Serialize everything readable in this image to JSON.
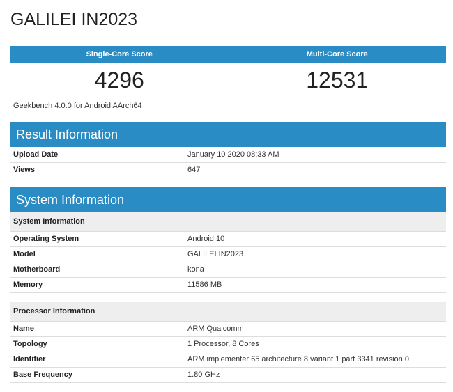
{
  "device_title": "GALILEI IN2023",
  "scores": {
    "single_label": "Single-Core Score",
    "multi_label": "Multi-Core Score",
    "single_value": "4296",
    "multi_value": "12531"
  },
  "version_note": "Geekbench 4.0.0 for Android AArch64",
  "result_info": {
    "title": "Result Information",
    "rows": [
      {
        "key": "Upload Date",
        "value": "January 10 2020 08:33 AM"
      },
      {
        "key": "Views",
        "value": "647"
      }
    ]
  },
  "system_info": {
    "title": "System Information",
    "groups": [
      {
        "heading": "System Information",
        "rows": [
          {
            "key": "Operating System",
            "value": "Android 10"
          },
          {
            "key": "Model",
            "value": "GALILEI IN2023"
          },
          {
            "key": "Motherboard",
            "value": "kona"
          },
          {
            "key": "Memory",
            "value": "11586 MB"
          }
        ]
      },
      {
        "heading": "Processor Information",
        "rows": [
          {
            "key": "Name",
            "value": "ARM Qualcomm"
          },
          {
            "key": "Topology",
            "value": "1 Processor, 8 Cores"
          },
          {
            "key": "Identifier",
            "value": "ARM implementer 65 architecture 8 variant 1 part 3341 revision 0"
          },
          {
            "key": "Base Frequency",
            "value": "1.80 GHz"
          }
        ]
      }
    ]
  },
  "colors": {
    "accent": "#2a8cc4",
    "subheader_bg": "#eeeeee"
  }
}
